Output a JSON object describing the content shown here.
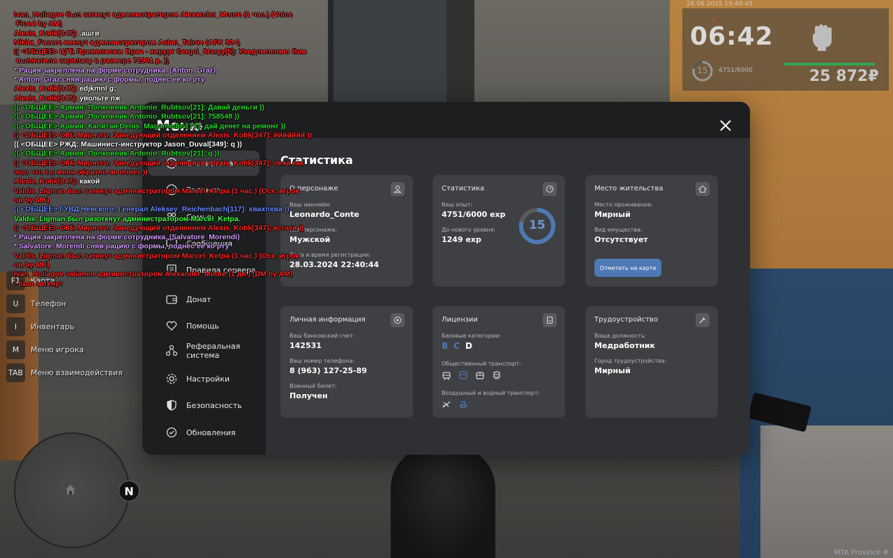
{
  "chat": [
    {
      "parts": [
        {
          "t": "Ivan_Huliagov был заткнут администратором Alexander_Moore (1 час.) (Voice\n Flood by AM)",
          "c": "red"
        }
      ]
    },
    {
      "parts": [
        {
          "t": "Alexis_Kotik[347]: ",
          "c": "red"
        },
        {
          "t": ".ашгв",
          "c": "white"
        }
      ]
    },
    {
      "parts": [
        {
          "t": "Nikita_Fasero кикнут администратором Aslan_Tairov (AFK 30+)",
          "c": "red"
        }
      ]
    },
    {
      "parts": [
        {
          "t": "(( <ОБЩЕЕ> ЦГБ Приволжска: Врач - хирург Sergei_Staryy[5]: Уведомление: Вам\n выплатили зарплату в размере 72901 р. ))",
          "c": "red"
        }
      ]
    },
    {
      "parts": [
        {
          "t": "* Рация закреплена на форме сотрудника. (Anton_Graz)",
          "c": "purple"
        }
      ]
    },
    {
      "parts": [
        {
          "t": "* Anton_Graz сняв рацию с формы, поднёс её ко рту",
          "c": "purple"
        }
      ]
    },
    {
      "parts": [
        {
          "t": "Alexis_Kotik[347]: ",
          "c": "red"
        },
        {
          "t": "edjkmnl g;",
          "c": "white"
        }
      ]
    },
    {
      "parts": [
        {
          "t": "Alexis_Kotik[347]: ",
          "c": "red"
        },
        {
          "t": "увольте пж",
          "c": "white"
        }
      ]
    },
    {
      "parts": [
        {
          "t": "(( <ОБЩЕЕ> Армия: Полковник Antonio_Rubtsov[21]: Давай деньги ))",
          "c": "green"
        }
      ]
    },
    {
      "parts": [
        {
          "t": "(( <ОБЩЕЕ> Армия: Полковник Antonio_Rubtsov[21]: 758548 ))",
          "c": "green"
        }
      ]
    },
    {
      "parts": [
        {
          "t": "(( <ОБЩЕЕ> Армия: Капитан Denis_Magamedov[??]: дай денег на ремонт ))",
          "c": "green"
        }
      ]
    },
    {
      "parts": [
        {
          "t": "(( <ОБЩЕЕ> ОКБ Мирного: Заведующий отделением Alexis_Kotik[347]: ййййййй ))",
          "c": "red"
        }
      ]
    },
    {
      "parts": [
        {
          "t": "(( <ОБЩЕЕ> РЖД: Машинист-инструктор Jason_Duval[349]: q ))",
          "c": "white"
        }
      ]
    },
    {
      "parts": [
        {
          "t": "(( <ОБЩЕЕ> Армия: Полковник Antonio_Rubtsov[21]: q ))",
          "c": "green"
        }
      ]
    },
    {
      "parts": [
        {
          "t": "(( <ОБЩЕЕ> ОКБ Мирного: Заведующий отделением Alexis_Kotik[347]: леха как\nэшо что ты меня обратно не повез ))",
          "c": "red"
        }
      ]
    },
    {
      "parts": [
        {
          "t": "Alexis_Kotik[347]: ",
          "c": "red"
        },
        {
          "t": "какой",
          "c": "white"
        }
      ]
    },
    {
      "parts": [
        {
          "t": "Valdis_Ligman был заткнут администратором Marcel_Ketpa (1 час.) (Оск. игрок\nов by MK)",
          "c": "red"
        }
      ]
    },
    {
      "parts": [
        {
          "t": "(( <ОБЩЕЕ> ГУВД Невского: Генерал Aleksey_Reichenbach[117]: хвахпхва ))",
          "c": "blue"
        }
      ]
    },
    {
      "parts": [
        {
          "t": "Valdis_Ligman был разоткнут администратором Marcel_Ketpa.",
          "c": "lime"
        }
      ]
    },
    {
      "parts": [
        {
          "t": "(( <ОБЩЕЕ> ОКБ Мирного: Заведующий отделением Alexis_Kotik[347]: кстати ))",
          "c": "red"
        }
      ]
    },
    {
      "parts": [
        {
          "t": "* Рация закреплена на форме сотрудника. (Salvatore_Morendi)",
          "c": "purple"
        }
      ]
    },
    {
      "parts": [
        {
          "t": "* Salvatore_Morendi сняв рацию с формы, поднёс её ко рту",
          "c": "purple"
        }
      ]
    },
    {
      "parts": [
        {
          "t": "Valdis_Ligman был заткнут администратором Marcel_Ketpa (1 час.) (Оск. игрок\nов by MK)",
          "c": "red"
        }
      ]
    },
    {
      "parts": [
        {
          "t": "Ivan_Huliagov забанен администратором Alexander_Moore (1 дн.) (DM by AM)\n- был заткнут",
          "c": "red"
        }
      ]
    }
  ],
  "hud": {
    "date": "26.06.2025 19:48:45",
    "time": "06:42",
    "level": "15",
    "exp": "4751/6000",
    "money": "25 872₽",
    "alert_icon": "!!"
  },
  "keybinds": [
    {
      "key": "F1",
      "label": "Карта"
    },
    {
      "key": "U",
      "label": "Телефон"
    },
    {
      "key": "I",
      "label": "Инвентарь"
    },
    {
      "key": "M",
      "label": "Меню игрока"
    },
    {
      "key": "TAB",
      "label": "Меню взаимодействия"
    }
  ],
  "minimap": {
    "north": "N"
  },
  "watermark": "MTA Province #",
  "menu": {
    "title": "Меню",
    "sidebar": [
      {
        "label": "Статистика",
        "icon": "clock-icon",
        "active": true
      },
      {
        "label": "Задания",
        "icon": "task-icon",
        "active": false
      },
      {
        "label": "Семья",
        "icon": "family-icon",
        "active": false
      },
      {
        "label": "Сообщения",
        "icon": "chat-icon",
        "active": false
      },
      {
        "label": "Правила сервера",
        "icon": "rules-icon",
        "active": false
      },
      {
        "label": "Донат",
        "icon": "wallet-icon",
        "active": false
      },
      {
        "label": "Помощь",
        "icon": "help-icon",
        "active": false
      },
      {
        "label": "Реферальная\nсистема",
        "icon": "referral-icon",
        "active": false
      },
      {
        "label": "Настройки",
        "icon": "gear-icon",
        "active": false
      },
      {
        "label": "Безопасность",
        "icon": "shield-icon",
        "active": false
      },
      {
        "label": "Обновления",
        "icon": "update-icon",
        "active": false
      }
    ],
    "section_title": "Статистика",
    "character": {
      "title": "О персонаже",
      "nickname_label": "Ваш никнейм:",
      "nickname": "Leonardo_Conte",
      "gender_label": "Пол персонажа:",
      "gender": "Мужской",
      "reg_label": "Дата и время регистрации:",
      "reg": "28.03.2024 22:40:44"
    },
    "stats": {
      "title": "Статистика",
      "exp_label": "Ваш опыт:",
      "exp": "4751/6000 exp",
      "next_label": "До нового уровня:",
      "next": "1249 exp",
      "level": "15",
      "progress": 0.79
    },
    "residence": {
      "title": "Место жительства",
      "place_label": "Место проживания:",
      "place": "Мирный",
      "property_label": "Вид имущества:",
      "property": "Отсутствует",
      "button": "Отметить на карте"
    },
    "personal": {
      "title": "Личная информация",
      "bank_label": "Ваш банковский счет:",
      "bank": "142531",
      "phone_label": "Ваш номер телефона:",
      "phone": "8 (963) 127-25-89",
      "military_label": "Военный билет:",
      "military": "Получен"
    },
    "licenses": {
      "title": "Лицензии",
      "base_label": "Базовые категории:",
      "categories": [
        {
          "letter": "B",
          "color": "#4e79b5"
        },
        {
          "letter": "C",
          "color": "#4e79b5"
        },
        {
          "letter": "D",
          "color": "#ffffff"
        }
      ],
      "public_label": "Общественный транспорт:",
      "air_label": "Воздушный и водный транспорт:"
    },
    "employment": {
      "title": "Трудоустройство",
      "position_label": "Ваша должность:",
      "position": "Медработник",
      "city_label": "Город трудоустройства:",
      "city": "Мирный"
    }
  }
}
